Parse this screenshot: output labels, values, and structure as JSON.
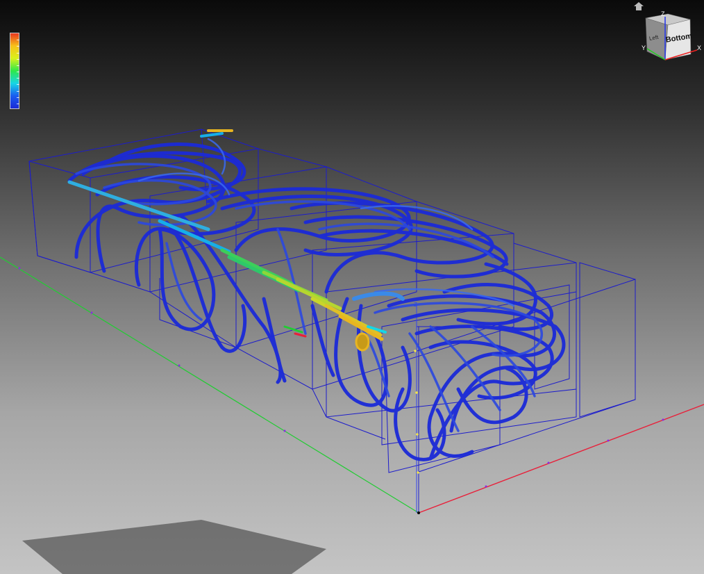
{
  "viewport": {
    "background_top": "#0a0a0a",
    "background_bottom": "#c4c4c4",
    "legend": {
      "colormap": [
        "#e8361f",
        "#f7c21a",
        "#d9f21b",
        "#2ee84a",
        "#17d6e6",
        "#1a5cf0",
        "#1b2ad8"
      ]
    },
    "model": {
      "enclosure_line_color": "#1c1ccc",
      "streamline_colors": [
        "#1f33c9",
        "#2b48e0",
        "#3a6af0",
        "#17aee8",
        "#3ccf5a",
        "#c9d62a",
        "#e8b520"
      ]
    },
    "axes": {
      "x_color": "#e8203a",
      "y_color": "#22cc33",
      "z_color": "#3344ee"
    },
    "triad_label": "Z"
  },
  "viewcube": {
    "face_label": "Bottom",
    "side_label": "Left",
    "axes": {
      "x": "X",
      "y": "Y",
      "z": "Z"
    }
  },
  "home_icon": "home-icon"
}
